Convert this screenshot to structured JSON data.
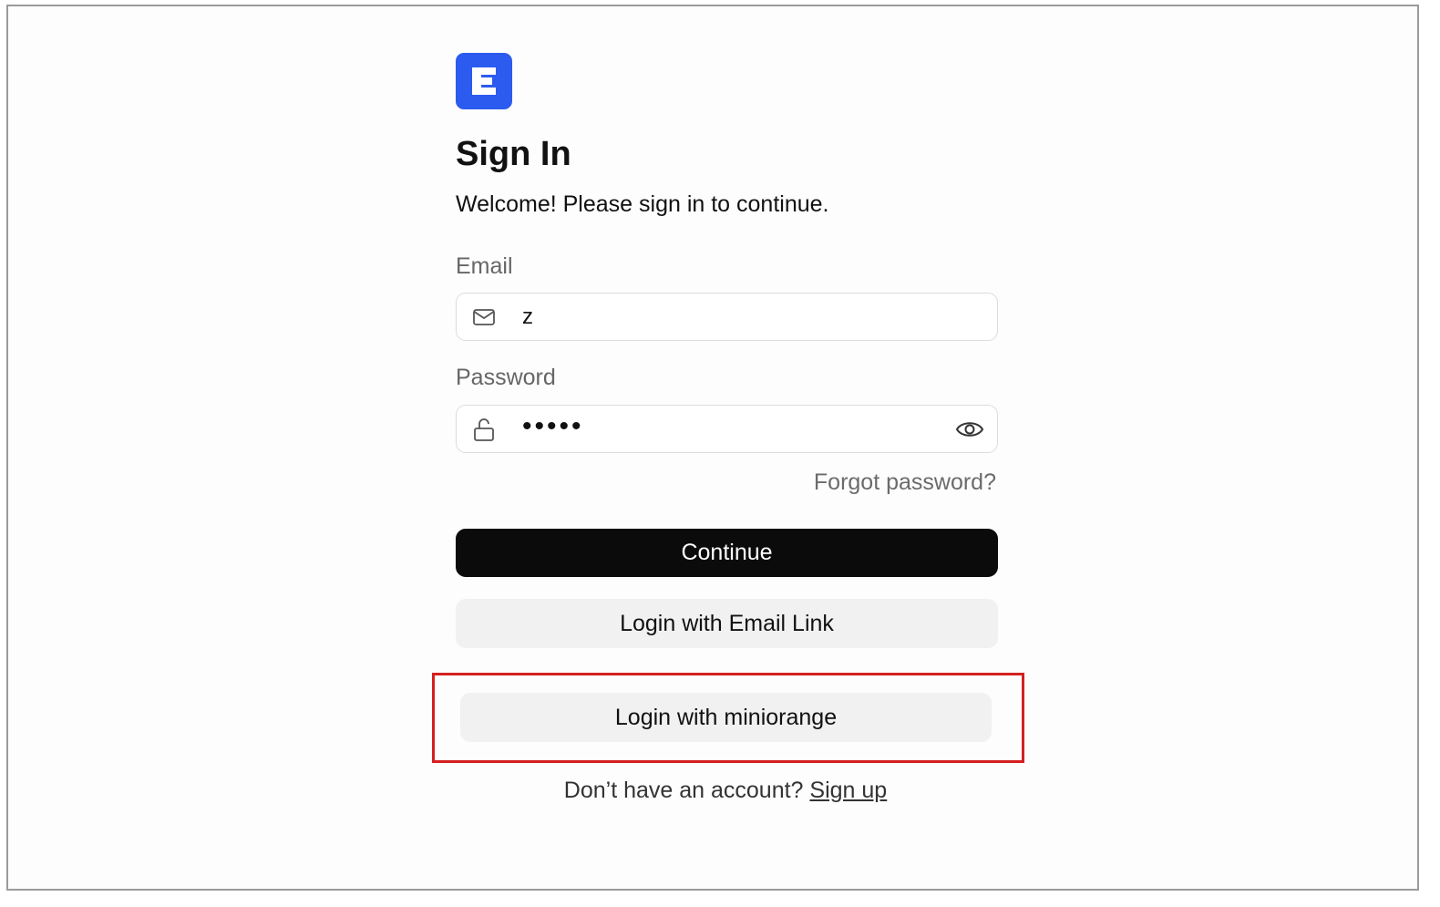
{
  "brand": {
    "logo_letter": "E",
    "accent_color": "#2c5bf0"
  },
  "header": {
    "title": "Sign In",
    "subtitle": "Welcome! Please sign in to continue."
  },
  "form": {
    "email_label": "Email",
    "email_value": "z",
    "email_icon": "mail-icon",
    "password_label": "Password",
    "password_value": "•••••",
    "password_icon": "lock-icon",
    "password_toggle_icon": "eye-icon",
    "forgot_password": "Forgot password?"
  },
  "actions": {
    "continue": "Continue",
    "email_link": "Login with Email Link",
    "sso": "Login with miniorange"
  },
  "footer": {
    "prompt": "Don’t have an account?",
    "signup": "Sign up"
  },
  "annotation": {
    "highlight_color": "#d42020"
  }
}
